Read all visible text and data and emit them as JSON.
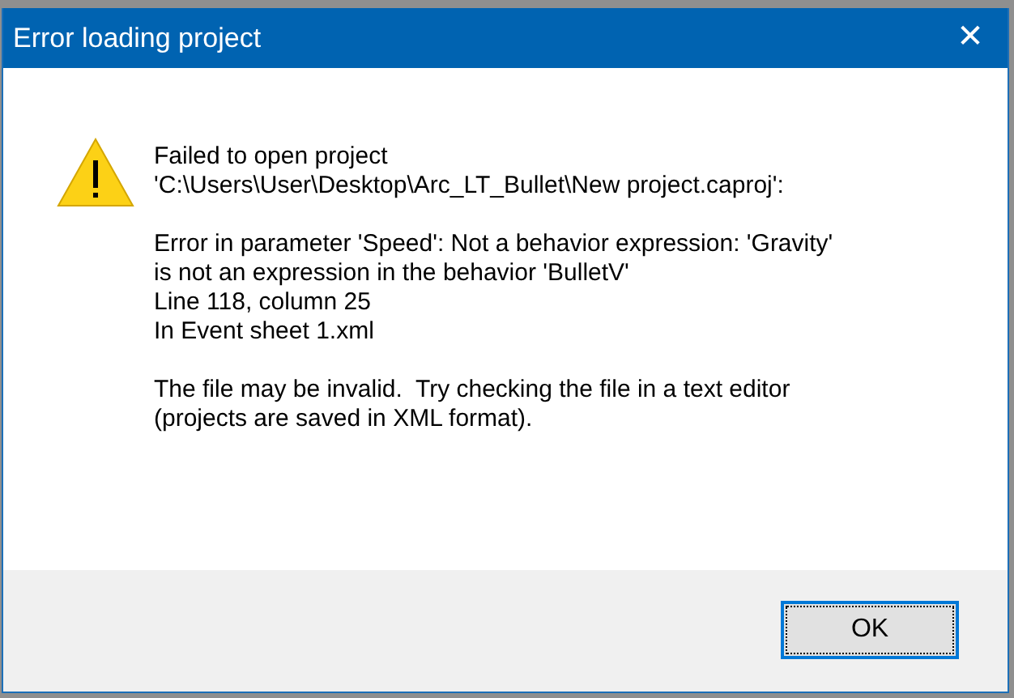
{
  "window": {
    "title": "Error loading project",
    "close": "✕"
  },
  "message": {
    "paragraphs": [
      [
        "Failed to open project",
        "'C:\\Users\\User\\Desktop\\Arc_LT_Bullet\\New project.caproj':"
      ],
      [
        "Error in parameter 'Speed': Not a behavior expression: 'Gravity'",
        "is not an expression in the behavior 'BulletV'",
        "Line 118, column 25",
        "In Event sheet 1.xml"
      ],
      [
        "The file may be invalid.  Try checking the file in a text editor",
        "(projects are saved in XML format)."
      ]
    ]
  },
  "buttons": [
    {
      "label": "OK",
      "focused": true
    }
  ]
}
